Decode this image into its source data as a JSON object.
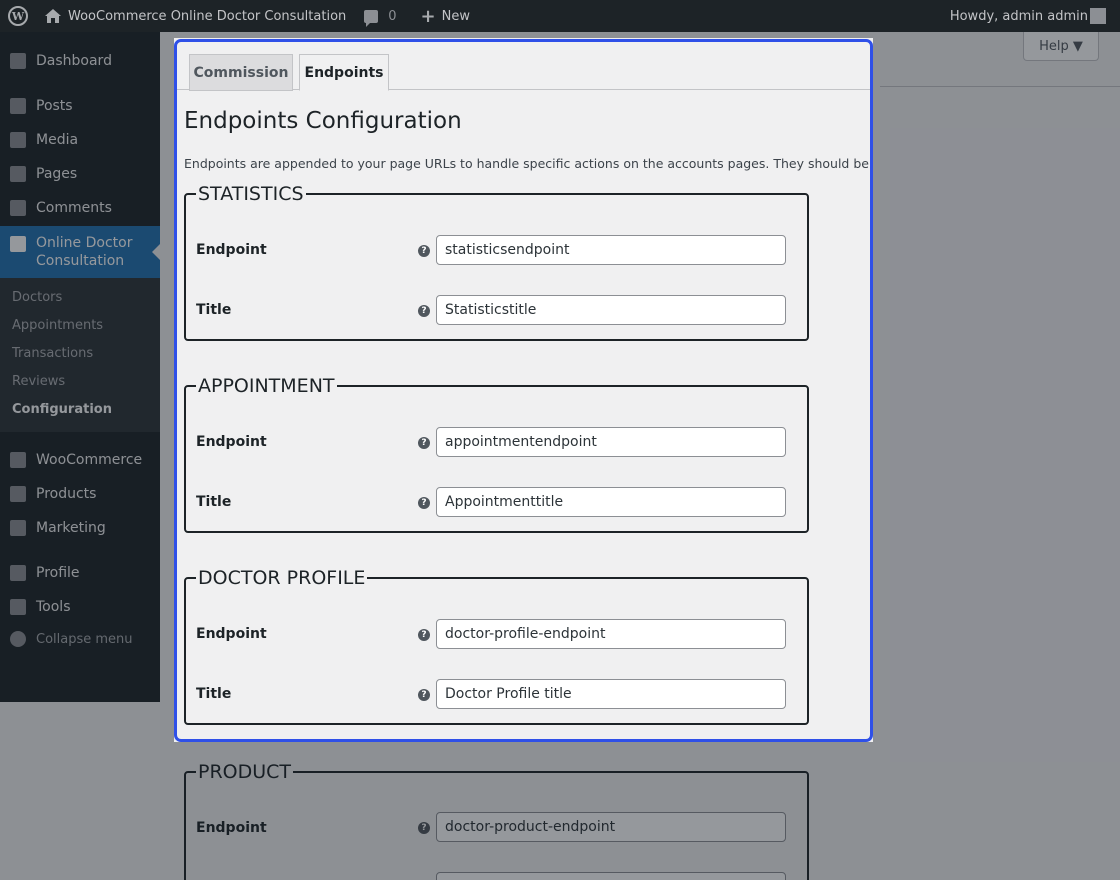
{
  "adminbar": {
    "site_name": "WooCommerce Online Doctor Consultation",
    "comment_count": "0",
    "new_label": "New",
    "howdy": "Howdy, admin admin"
  },
  "sidebar": {
    "items": [
      {
        "label": "Dashboard",
        "icon": "dashboard-icon"
      },
      {
        "label": "Posts",
        "icon": "pin-icon"
      },
      {
        "label": "Media",
        "icon": "media-icon"
      },
      {
        "label": "Pages",
        "icon": "pages-icon"
      },
      {
        "label": "Comments",
        "icon": "comment-icon"
      },
      {
        "label": "Online Doctor Consultation",
        "icon": "document-icon"
      },
      {
        "label": "WooCommerce",
        "icon": "woo-icon"
      },
      {
        "label": "Products",
        "icon": "archive-icon"
      },
      {
        "label": "Marketing",
        "icon": "megaphone-icon"
      },
      {
        "label": "Profile",
        "icon": "user-icon"
      },
      {
        "label": "Tools",
        "icon": "wrench-icon"
      },
      {
        "label": "Collapse menu",
        "icon": "collapse-icon"
      }
    ],
    "submenu": [
      "Doctors",
      "Appointments",
      "Transactions",
      "Reviews",
      "Configuration"
    ]
  },
  "help_label": "Help ▼",
  "tabs": [
    "Commission",
    "Endpoints"
  ],
  "page_title": "Endpoints Configuration",
  "description": "Endpoints are appended to your page URLs to handle specific actions on the accounts pages. They should be unique.",
  "sections": [
    {
      "legend": "STATISTICS",
      "endpoint_label": "Endpoint",
      "endpoint_value": "statisticsendpoint",
      "title_label": "Title",
      "title_value": "Statisticstitle"
    },
    {
      "legend": "APPOINTMENT",
      "endpoint_label": "Endpoint",
      "endpoint_value": "appointmentendpoint",
      "title_label": "Title",
      "title_value": "Appointmenttitle"
    },
    {
      "legend": "DOCTOR PROFILE",
      "endpoint_label": "Endpoint",
      "endpoint_value": "doctor-profile-endpoint",
      "title_label": "Title",
      "title_value": "Doctor Profile title"
    },
    {
      "legend": "PRODUCT",
      "endpoint_label": "Endpoint",
      "endpoint_value": "doctor-product-endpoint"
    }
  ],
  "colors": {
    "highlight": "#2f50e8",
    "admin_dark": "#1d2327",
    "active_menu": "#2271b1"
  }
}
